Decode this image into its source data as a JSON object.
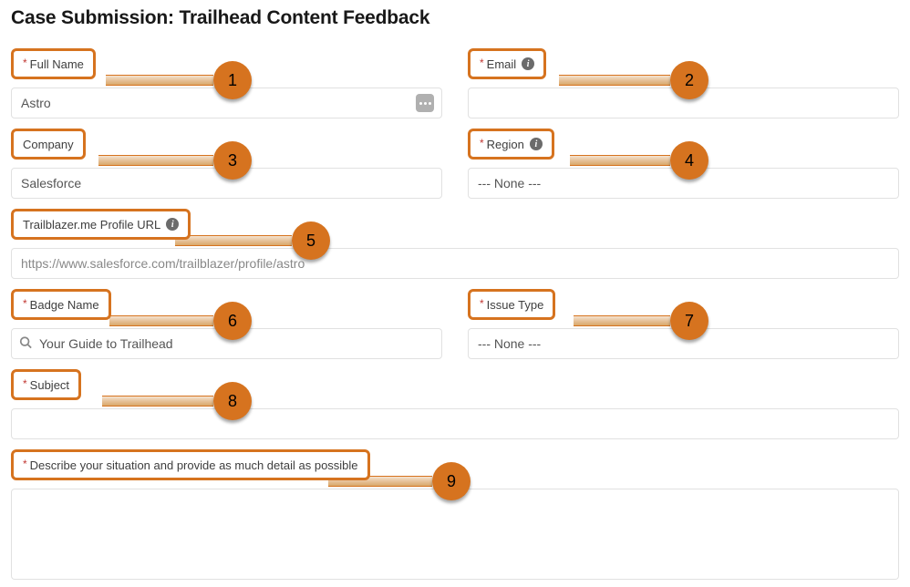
{
  "title": "Case Submission: Trailhead Content Feedback",
  "callouts": {
    "n1": "1",
    "n2": "2",
    "n3": "3",
    "n4": "4",
    "n5": "5",
    "n6": "6",
    "n7": "7",
    "n8": "8",
    "n9": "9"
  },
  "fields": {
    "fullName": {
      "label": "Full Name",
      "required": true,
      "value": "Astro",
      "hasInfo": false
    },
    "email": {
      "label": "Email",
      "required": true,
      "value": "",
      "hasInfo": true
    },
    "company": {
      "label": "Company",
      "required": false,
      "value": "Salesforce",
      "hasInfo": false
    },
    "region": {
      "label": "Region",
      "required": true,
      "value": "--- None ---",
      "hasInfo": true
    },
    "profileUrl": {
      "label": "Trailblazer.me Profile URL",
      "required": false,
      "value": "https://www.salesforce.com/trailblazer/profile/astro",
      "hasInfo": true
    },
    "badgeName": {
      "label": "Badge Name",
      "required": true,
      "value": "Your Guide to Trailhead",
      "hasInfo": false
    },
    "issueType": {
      "label": "Issue Type",
      "required": true,
      "value": "--- None ---",
      "hasInfo": false
    },
    "subject": {
      "label": "Subject",
      "required": true,
      "value": "",
      "hasInfo": false
    },
    "describe": {
      "label": "Describe your situation and provide as much detail as possible",
      "required": true,
      "value": "",
      "hasInfo": false
    }
  },
  "required_marker": "*",
  "info_glyph": "i"
}
